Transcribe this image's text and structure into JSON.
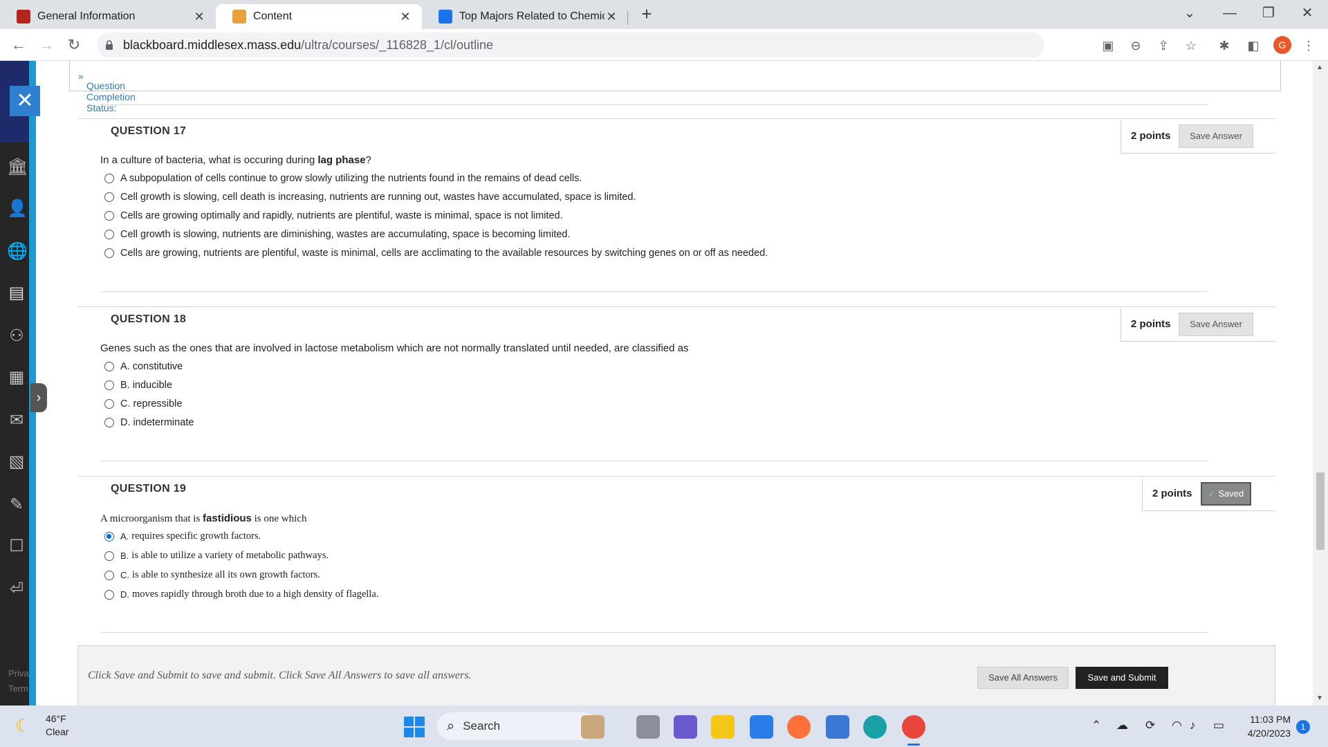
{
  "browser": {
    "tabs": [
      {
        "title": "General Information",
        "favicon_color": "#b3261e"
      },
      {
        "title": "Content",
        "favicon_color": "#e9a23b"
      },
      {
        "title": "Top Majors Related to Chemical E",
        "favicon_color": "#1a73e8"
      }
    ],
    "url_domain": "blackboard.middlesex.mass.edu",
    "url_path": "/ultra/courses/_116828_1/cl/outline",
    "profile_initial": "G"
  },
  "leftnav": {
    "icons": [
      "institution-icon",
      "profile-icon",
      "globe-icon",
      "courses-icon",
      "groups-icon",
      "calendar-icon",
      "messages-icon",
      "grades-icon",
      "tools-icon",
      "edit-icon",
      "signout-icon"
    ],
    "footer_links": [
      "Priva",
      "Term"
    ]
  },
  "assessment": {
    "status_label": "Question Completion Status:",
    "questions": [
      {
        "title": "QUESTION 17",
        "points": "2 points",
        "save_label": "Save Answer",
        "text_before": "In a culture of bacteria, what is occuring during ",
        "text_bold": "lag phase",
        "text_after": "?",
        "options": [
          "A subpopulation of cells continue to grow slowly utilizing the nutrients found in the remains of dead cells.",
          "Cell growth is slowing, cell death is increasing, nutrients are running out, wastes have accumulated, space is limited.",
          "Cells are growing optimally and rapidly, nutrients are plentiful, waste is minimal, space is not limited.",
          "Cell growth is slowing, nutrients are diminishing, wastes are accumulating, space is becoming limited.",
          "Cells are growing, nutrients are plentiful, waste is minimal, cells are acclimating to the available resources by switching genes on or off as needed."
        ]
      },
      {
        "title": "QUESTION 18",
        "points": "2 points",
        "save_label": "Save Answer",
        "text": "Genes such as the ones that are involved in lactose metabolism which are not normally translated until needed, are classified as",
        "options": [
          {
            "letter": "A.",
            "text": "constitutive"
          },
          {
            "letter": "B.",
            "text": "inducible"
          },
          {
            "letter": "C.",
            "text": "repressible"
          },
          {
            "letter": "D.",
            "text": "indeterminate"
          }
        ]
      },
      {
        "title": "QUESTION 19",
        "points": "2 points",
        "saved_label": "Saved",
        "text_before": "A microorganism that is ",
        "text_bold": "fastidious",
        "text_after": " is one which",
        "selected_index": 0,
        "options": [
          {
            "letter": "A.",
            "text": "requires specific growth factors."
          },
          {
            "letter": "B.",
            "text": "is able to utilize a variety of metabolic pathways."
          },
          {
            "letter": "C.",
            "text": "is able to synthesize all its own growth factors."
          },
          {
            "letter": "D.",
            "text": "moves rapidly through broth due to a high density of flagella."
          }
        ]
      }
    ],
    "submit_message": "Click Save and Submit to save and submit. Click Save All Answers to save all answers.",
    "save_all_label": "Save All Answers",
    "save_submit_label": "Save and Submit"
  },
  "taskbar": {
    "temperature": "46°F",
    "condition": "Clear",
    "search_label": "Search",
    "time": "11:03 PM",
    "date": "4/20/2023",
    "notification_count": "1"
  }
}
